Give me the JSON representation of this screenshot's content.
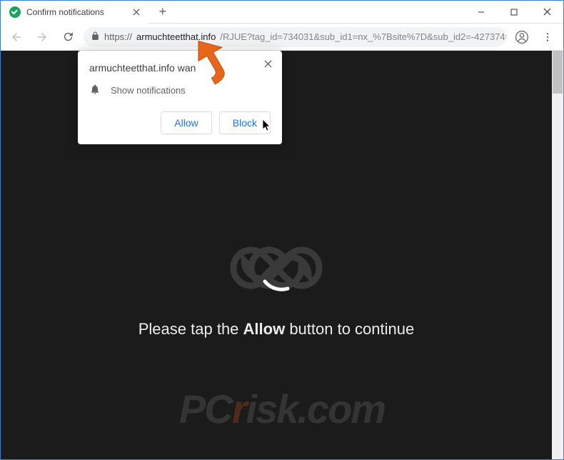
{
  "window": {
    "tab_title": "Confirm notifications"
  },
  "toolbar": {
    "url_scheme": "https://",
    "url_domain": "armuchteetthat.info",
    "url_path": "/RJUE?tag_id=734031&sub_id1=nx_%7Bsite%7D&sub_id2=-4273749..."
  },
  "permission": {
    "title_text": "armuchteetthat.info wan",
    "body": "Show notifications",
    "allow": "Allow",
    "block": "Block"
  },
  "page": {
    "pre": "Please tap the ",
    "bold": "Allow",
    "post": " button to continue"
  },
  "watermark": {
    "p": "P",
    "c": "C",
    "r": "r",
    "rest": "isk.com"
  }
}
